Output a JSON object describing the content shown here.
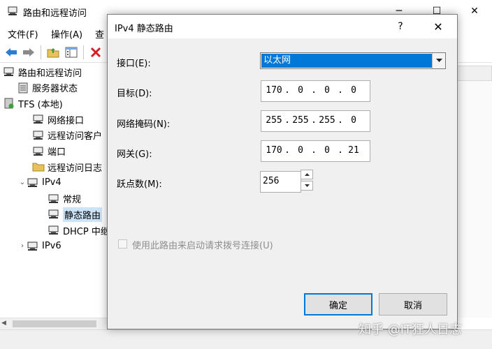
{
  "background_window": {
    "title": "路由和远程访问",
    "menu": [
      "文件(F)",
      "操作(A)",
      "查"
    ],
    "caption": {
      "minimize": "─",
      "maximize": "☐",
      "close": "✕"
    },
    "tree": [
      {
        "label": "路由和远程访问",
        "icon": "routing-icon",
        "level": 0,
        "twisty": ""
      },
      {
        "label": "服务器状态",
        "icon": "server-status-icon",
        "level": 1,
        "twisty": ""
      },
      {
        "label": "TFS (本地)",
        "icon": "server-icon",
        "level": 0,
        "twisty": "⌄"
      },
      {
        "label": "网络接口",
        "icon": "network-interface-icon",
        "level": 2,
        "twisty": ""
      },
      {
        "label": "远程访问客户",
        "icon": "remote-client-icon",
        "level": 2,
        "twisty": ""
      },
      {
        "label": "端口",
        "icon": "port-icon",
        "level": 2,
        "twisty": ""
      },
      {
        "label": "远程访问日志",
        "icon": "folder-icon",
        "level": 2,
        "twisty": ""
      },
      {
        "label": "IPv4",
        "icon": "ipv4-icon",
        "level": 1,
        "twisty": "⌄"
      },
      {
        "label": "常规",
        "icon": "general-icon",
        "level": 3,
        "twisty": ""
      },
      {
        "label": "静态路由",
        "icon": "static-route-icon",
        "level": 3,
        "twisty": "",
        "selected": true
      },
      {
        "label": "DHCP 中继",
        "icon": "dhcp-relay-icon",
        "level": 3,
        "twisty": ""
      },
      {
        "label": "IPv6",
        "icon": "ipv6-icon",
        "level": 1,
        "twisty": "›"
      }
    ]
  },
  "dialog": {
    "title": "IPv4 静态路由",
    "help": "?",
    "close": "✕",
    "labels": {
      "interface": "接口(E):",
      "destination": "目标(D):",
      "netmask": "网络掩码(N):",
      "gateway": "网关(G):",
      "metric": "跃点数(M):"
    },
    "interface_value": "以太网",
    "destination": [
      "170",
      "0",
      "0",
      "0"
    ],
    "netmask": [
      "255",
      "255",
      "255",
      "0"
    ],
    "gateway": [
      "170",
      "0",
      "0",
      "21"
    ],
    "metric": "256",
    "demand_dial_label": "使用此路由来启动请求拨号连接(U)",
    "demand_dial_checked": false,
    "ok_label": "确定",
    "cancel_label": "取消"
  },
  "watermark": "知乎 @IT狂人日志",
  "colors": {
    "selection": "#0078d7",
    "tree_selected": "#cce4f7",
    "dialog_bg": "#f0f0f0"
  }
}
